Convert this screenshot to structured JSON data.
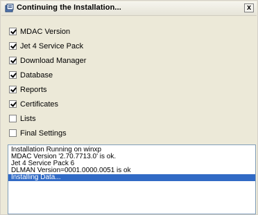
{
  "window": {
    "title": "Continuing the Installation...",
    "close_label": "x"
  },
  "steps": [
    {
      "label": "MDAC Version",
      "checked": true
    },
    {
      "label": "Jet 4 Service Pack",
      "checked": true
    },
    {
      "label": "Download Manager",
      "checked": true
    },
    {
      "label": "Database",
      "checked": true
    },
    {
      "label": "Reports",
      "checked": true
    },
    {
      "label": "Certificates",
      "checked": true
    },
    {
      "label": "Lists",
      "checked": false
    },
    {
      "label": "Final Settings",
      "checked": false
    }
  ],
  "log": {
    "lines": [
      "Installation Running on winxp",
      "MDAC Version '2.70.7713.0' is ok.",
      "Jet 4 Service Pack 6",
      "DLMAN Version=0001.0000.0051 is ok",
      "Installing Data..."
    ],
    "selected_index": 4
  }
}
